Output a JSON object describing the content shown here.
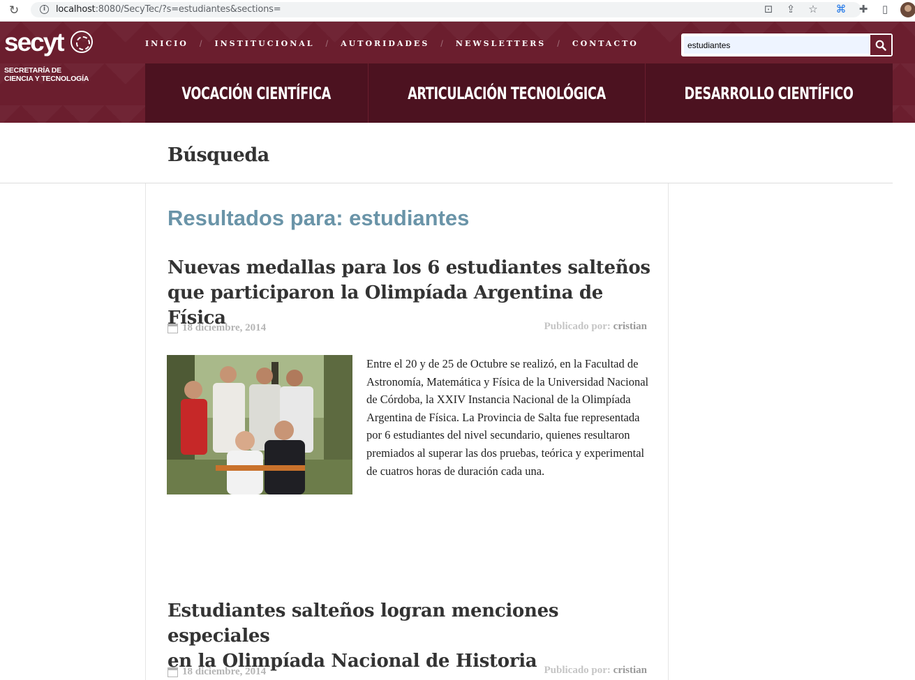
{
  "browser": {
    "url_host": "localhost",
    "url_rest": ":8080/SecyTec/?s=estudiantes&sections="
  },
  "logo": {
    "word": "secyt",
    "subtitle_line1": "SECRETARÍA DE",
    "subtitle_line2": "CIENCIA Y TECNOLOGÍA"
  },
  "top_nav": [
    "INICIO",
    "INSTITUCIONAL",
    "AUTORIDADES",
    "NEWSLETTERS",
    "CONTACTO"
  ],
  "search": {
    "value": "estudiantes"
  },
  "sections": [
    "VOCACIÓN CIENTÍFICA",
    "ARTICULACIÓN TECNOLÓGICA",
    "DESARROLLO CIENTÍFICO"
  ],
  "page": {
    "title": "Búsqueda"
  },
  "results": {
    "prefix": "Resultados para:",
    "query": "estudiantes"
  },
  "posts": [
    {
      "title_line1": "Nuevas medallas para los 6 estudiantes salteños",
      "title_line2": "que participaron la Olimpíada Argentina de Física",
      "date": "18 diciembre, 2014",
      "author_label": "Publicado por:",
      "author": "cristian",
      "excerpt": "Entre el 20 y de 25 de Octubre se realizó, en la Facultad de Astronomía, Matemática y Física de la Universidad Nacional de Córdoba, la XXIV Instancia Nacional de la Olimpíada Argentina de Física. La Provincia de Salta fue representada por 6 estudiantes del nivel secundario, quienes resultaron premiados al superar las dos pruebas, teórica y experimental de cuatros horas de duración cada una."
    },
    {
      "title_line1": "Estudiantes salteños logran menciones especiales",
      "title_line2": "en la Olimpíada Nacional de Historia",
      "date": "18 diciembre, 2014",
      "author_label": "Publicado por:",
      "author": "cristian"
    }
  ],
  "colors": {
    "header_bg": "#6b1e2e",
    "section_bg": "#4c1220",
    "results_heading": "#6a94a8"
  }
}
